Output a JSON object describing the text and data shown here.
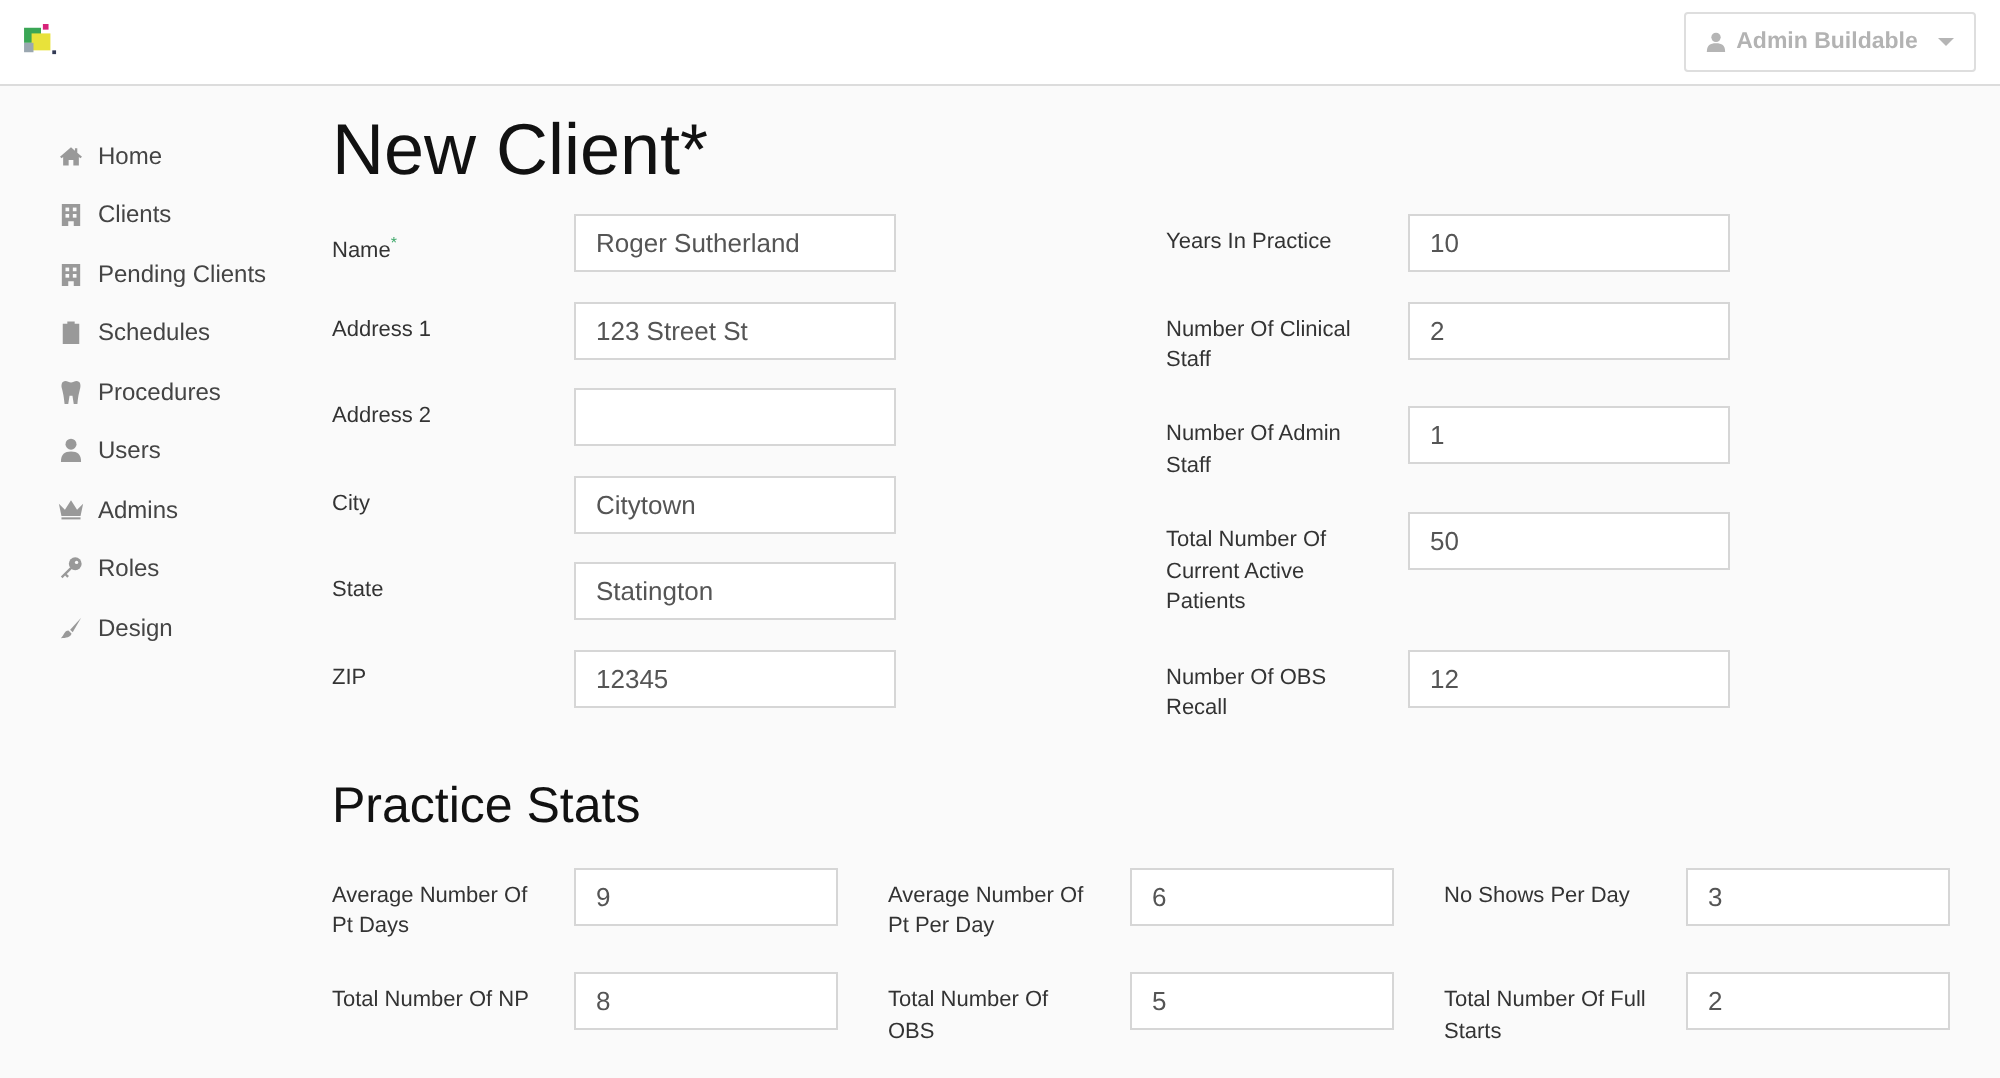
{
  "header": {
    "user_menu": {
      "label": "Admin Buildable"
    }
  },
  "sidebar": {
    "items": [
      {
        "label": "Home",
        "selected": false
      },
      {
        "label": "Clients",
        "selected": false
      },
      {
        "label": "Pending Clients",
        "selected": false
      },
      {
        "label": "Schedules",
        "selected": false
      },
      {
        "label": "Procedures",
        "selected": false
      },
      {
        "label": "Users",
        "selected": false
      },
      {
        "label": "Admins",
        "selected": false
      },
      {
        "label": "Roles",
        "selected": false
      },
      {
        "label": "Design",
        "selected": false
      }
    ]
  },
  "page": {
    "title": "New Client*",
    "client_fields": [
      {
        "label": "Name$^{*}$",
        "value": "Roger Sutherland"
      },
      {
        "label": "Address 1",
        "value": "123 Street St"
      },
      {
        "label": "Address 2"
      },
      {
        "label": "City",
        "value": "Citytown"
      },
      {
        "label": "State",
        "value": "Statington"
      },
      {
        "label": "ZIP",
        "value": "12345"
      }
    ],
    "practice_fields": [
      {
        "label": "Years In Practice",
        "value": "10"
      },
      {
        "label": "Number Of Clinical Staff",
        "value": "2"
      },
      {
        "label": "Number Of Admin Staff",
        "value": "1"
      },
      {
        "label": "Total Number Of Current Active Patients",
        "value": "50"
      },
      {
        "label": "Number Of OBS Recall",
        "value": "12"
      }
    ]
  },
  "practice_stats": {
    "title": "Practice Stats",
    "fields": [
      {
        "label": "Average Number Of Pt Days",
        "value": "9"
      },
      {
        "label": "Average Number Of Pt Per Day",
        "value": "6"
      },
      {
        "label": "No Shows Per Day",
        "value": "3"
      },
      {
        "label": "Total Number Of NP",
        "value": "8"
      },
      {
        "label": "Total Number Of OBS",
        "value": "5"
      },
      {
        "label": "Total Number Of Full Starts",
        "value": "2"
      }
    ]
  }
}
